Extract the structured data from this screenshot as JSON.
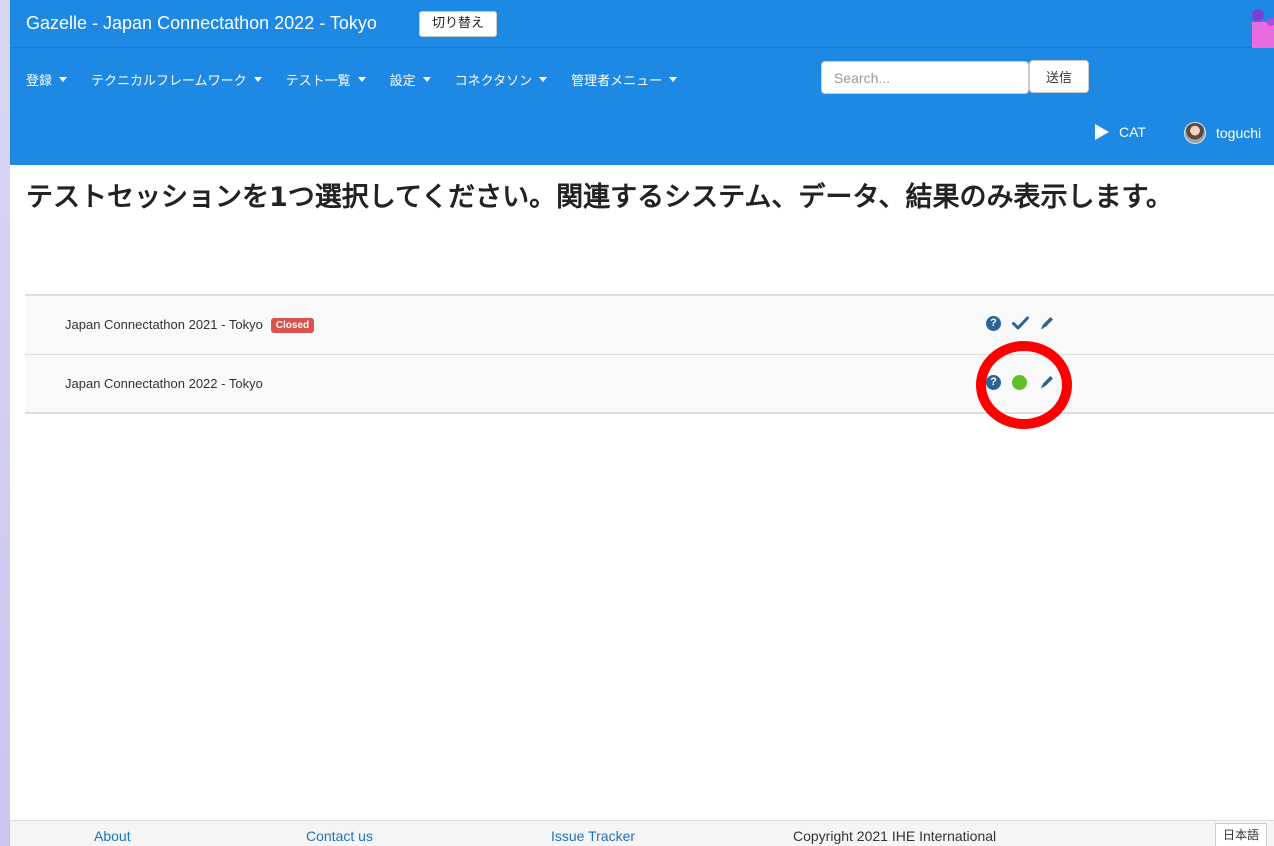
{
  "app": {
    "title": "Gazelle - Japan Connectathon 2022 - Tokyo",
    "switch_label": "切り替え"
  },
  "nav": {
    "items": [
      {
        "label": "登録",
        "has_dropdown": true
      },
      {
        "label": "テクニカルフレームワーク",
        "has_dropdown": true
      },
      {
        "label": "テスト一覧",
        "has_dropdown": true
      },
      {
        "label": "設定",
        "has_dropdown": true
      },
      {
        "label": "コネクタソン",
        "has_dropdown": true
      },
      {
        "label": "管理者メニュー",
        "has_dropdown": true
      }
    ],
    "search_placeholder": "Search...",
    "send_label": "送信",
    "cat_label": "CAT",
    "user_name": "toguchi"
  },
  "main": {
    "title": "テストセッションを1つ選択してください。関連するシステム、データ、結果のみ表示します。",
    "sessions": [
      {
        "name": "Japan Connectathon 2021 - Tokyo",
        "badge": "Closed",
        "status_icon": "check-icon"
      },
      {
        "name": "Japan Connectathon 2022 - Tokyo",
        "badge": "",
        "status_icon": "green-dot-icon"
      }
    ],
    "icon_help_glyph": "?"
  },
  "annotation": {
    "highlight_color": "#ff0000"
  },
  "footer": {
    "about": "About",
    "contact": "Contact us",
    "issue_tracker": "Issue Tracker",
    "copyright": "Copyright 2021 IHE International",
    "language": "日本語"
  },
  "colors": {
    "primary": "#1e88e5",
    "badge_closed": "#d9534f",
    "active_dot": "#5fbf28",
    "icon_blue": "#2a6496"
  }
}
